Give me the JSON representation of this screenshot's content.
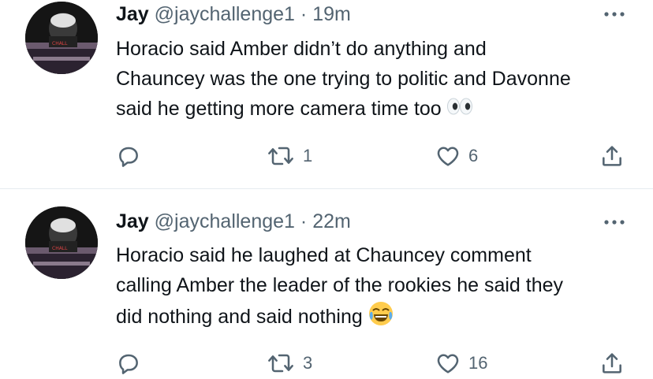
{
  "tweets": [
    {
      "name": "Jay",
      "handle": "@jaychallenge1",
      "separator": "·",
      "time": "19m",
      "lines": [
        "Horacio said Amber didn’t do anything and",
        "Chauncey was the one trying to politic and Davonne",
        "said he getting more camera time too"
      ],
      "emoji": "eyes-emoji",
      "retweets": "1",
      "likes": "6"
    },
    {
      "name": "Jay",
      "handle": "@jaychallenge1",
      "separator": "·",
      "time": "22m",
      "lines": [
        "Horacio said he laughed at Chauncey comment",
        "calling Amber the leader of the rookies he said they",
        "did nothing and said nothing"
      ],
      "emoji": "face-with-tears-of-joy-emoji",
      "retweets": "3",
      "likes": "16"
    }
  ],
  "colors": {
    "text": "#0f1419",
    "secondary": "#536471",
    "divider": "#e6ecf0"
  }
}
